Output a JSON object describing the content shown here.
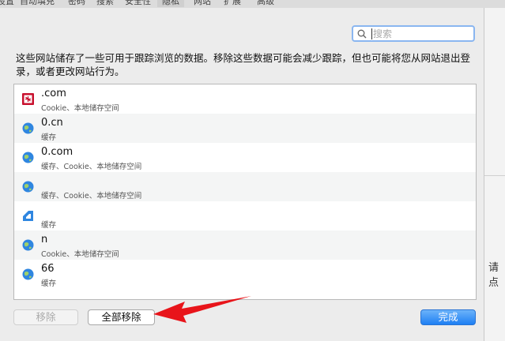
{
  "toolbar": {
    "tabs": [
      "设置",
      "自动填充",
      "密码",
      "搜索",
      "安全性",
      "隐私",
      "网站",
      "扩展",
      "高级"
    ],
    "active_tab": "隐私"
  },
  "search": {
    "placeholder": "搜索",
    "value": ""
  },
  "description": "这些网站储存了一些可用于跟踪浏览的数据。移除这些数据可能会减少跟踪，但也可能将您从网站退出登录，或者更改网站行为。",
  "sites": [
    {
      "name": ".com",
      "detail": "Cookie、本地储存空间",
      "icon": "site-logo-icon"
    },
    {
      "name": "0.cn",
      "detail": "缓存",
      "icon": "globe-icon"
    },
    {
      "name": "0.com",
      "detail": "缓存、Cookie、本地储存空间",
      "icon": "globe-icon"
    },
    {
      "name": "",
      "detail": "缓存、Cookie、本地储存空间",
      "icon": "globe-icon"
    },
    {
      "name": "",
      "detail": "缓存",
      "icon": "globe-icon"
    },
    {
      "name": "n",
      "detail": "Cookie、本地储存空间",
      "icon": "globe-icon"
    },
    {
      "name": "66",
      "detail": "缓存",
      "icon": "globe-icon"
    }
  ],
  "buttons": {
    "remove": "移除",
    "remove_all": "全部移除",
    "done": "完成"
  },
  "background_text": "请点",
  "colors": {
    "accent": "#1e7ff3",
    "arrow": "#e8141a"
  }
}
